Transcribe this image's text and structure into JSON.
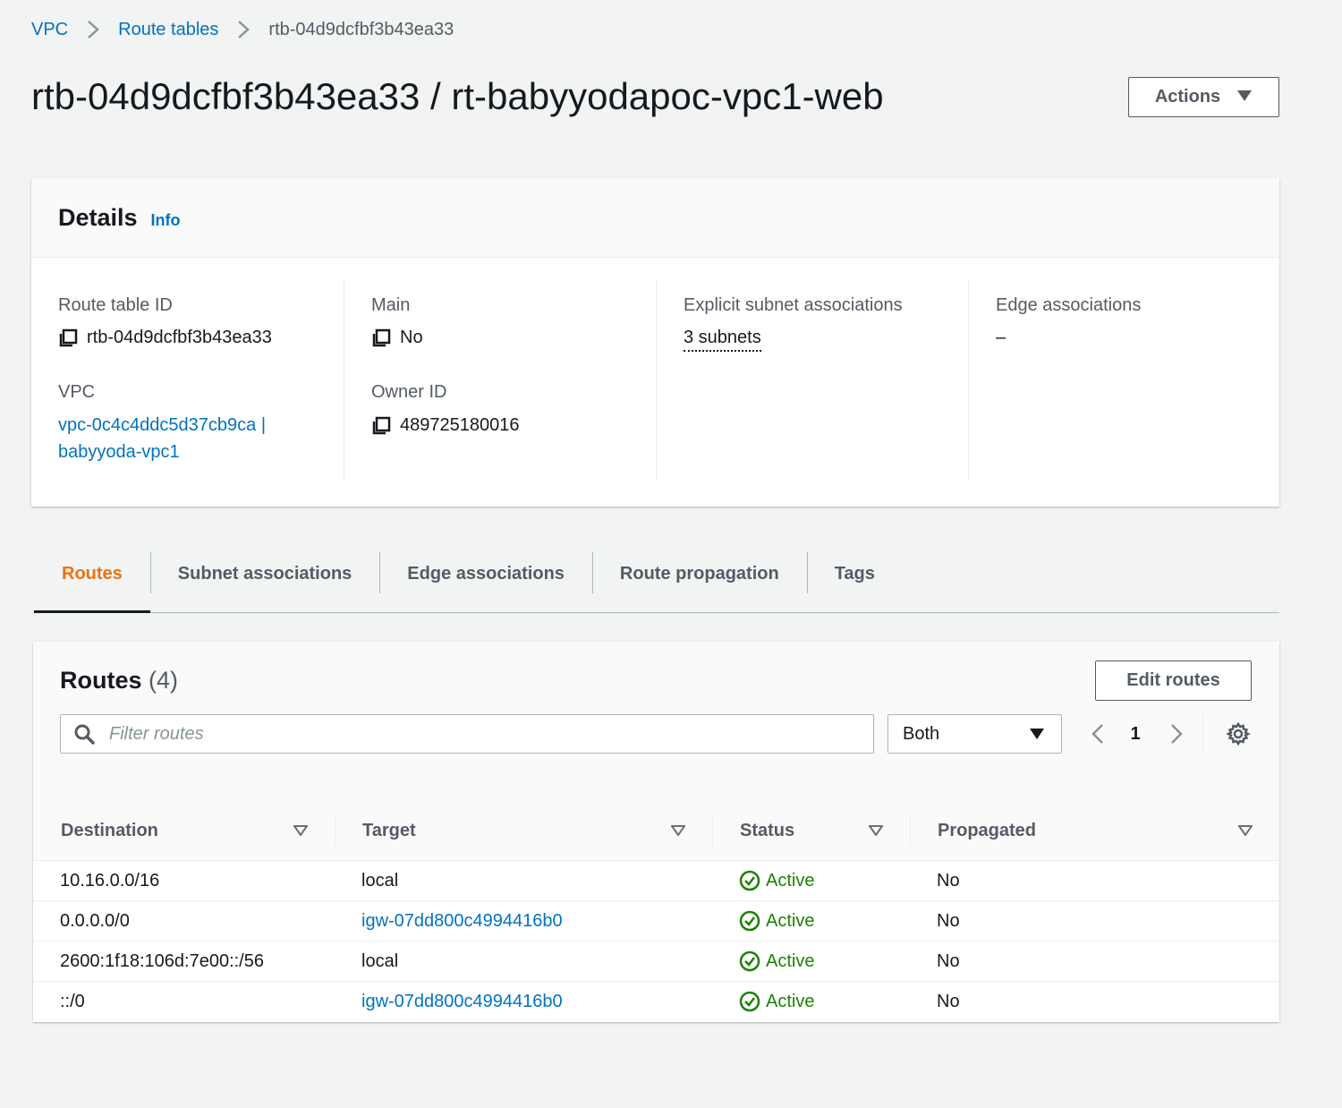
{
  "breadcrumb": {
    "items": [
      "VPC",
      "Route tables"
    ],
    "current": "rtb-04d9dcfbf3b43ea33"
  },
  "page": {
    "title": "rtb-04d9dcfbf3b43ea33 / rt-babyyodapoc-vpc1-web",
    "actions_label": "Actions"
  },
  "details": {
    "title": "Details",
    "info": "Info",
    "route_table_id": {
      "label": "Route table ID",
      "value": "rtb-04d9dcfbf3b43ea33"
    },
    "vpc": {
      "label": "VPC",
      "value_line1": "vpc-0c4c4ddc5d37cb9ca |",
      "value_line2": "babyyoda-vpc1"
    },
    "main": {
      "label": "Main",
      "value": "No"
    },
    "owner_id": {
      "label": "Owner ID",
      "value": "489725180016"
    },
    "explicit_subnets": {
      "label": "Explicit subnet associations",
      "value": "3 subnets"
    },
    "edge_associations": {
      "label": "Edge associations",
      "value": "–"
    }
  },
  "tabs": [
    "Routes",
    "Subnet associations",
    "Edge associations",
    "Route propagation",
    "Tags"
  ],
  "routes": {
    "title": "Routes",
    "count": "(4)",
    "edit_label": "Edit routes",
    "filter_placeholder": "Filter routes",
    "filter_select": "Both",
    "page": "1",
    "columns": [
      "Destination",
      "Target",
      "Status",
      "Propagated"
    ],
    "rows": [
      {
        "destination": "10.16.0.0/16",
        "target": "local",
        "target_link": false,
        "status": "Active",
        "propagated": "No"
      },
      {
        "destination": "0.0.0.0/0",
        "target": "igw-07dd800c4994416b0",
        "target_link": true,
        "status": "Active",
        "propagated": "No"
      },
      {
        "destination": "2600:1f18:106d:7e00::/56",
        "target": "local",
        "target_link": false,
        "status": "Active",
        "propagated": "No"
      },
      {
        "destination": "::/0",
        "target": "igw-07dd800c4994416b0",
        "target_link": true,
        "status": "Active",
        "propagated": "No"
      }
    ]
  },
  "colors": {
    "link": "#0073bb",
    "active_tab": "#ec7211",
    "success": "#1d8102",
    "background": "#f2f3f3"
  }
}
